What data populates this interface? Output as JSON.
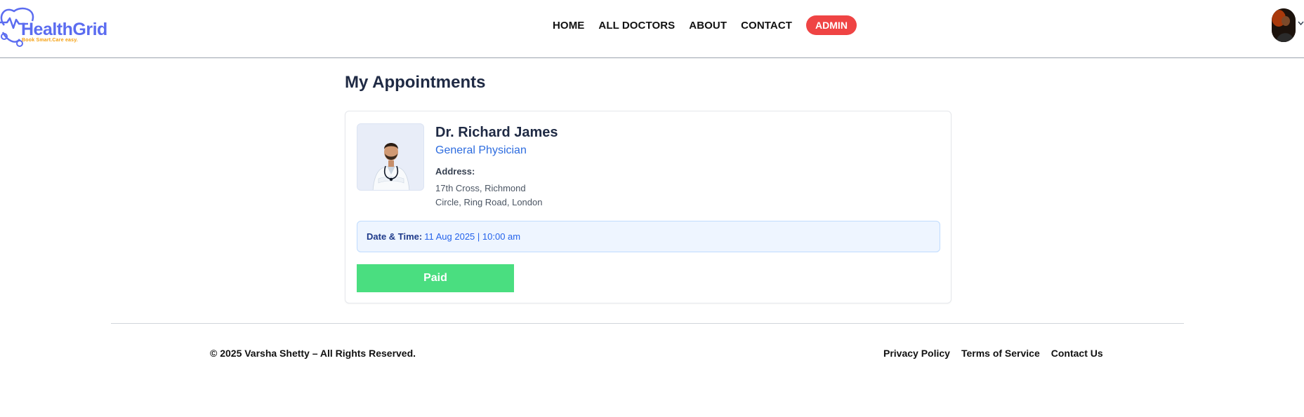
{
  "brand": {
    "name": "HealthGrid",
    "tagline": "Book Smart.Care easy.",
    "color": "#5b6cf0",
    "tagline_color": "#f59e0b"
  },
  "nav": {
    "items": [
      "HOME",
      "ALL DOCTORS",
      "ABOUT",
      "CONTACT"
    ],
    "admin_label": "ADMIN",
    "admin_color": "#ef4444"
  },
  "user_menu": {
    "avatar_icon": "user-avatar",
    "dropdown_icon": "chevron-down-icon"
  },
  "main": {
    "title": "My Appointments",
    "appointments": [
      {
        "doctor_name": "Dr. Richard James",
        "speciality": "General Physician",
        "address_label": "Address:",
        "address_line1": "17th Cross, Richmond",
        "address_line2": "Circle, Ring Road, London",
        "datetime_label": "Date & Time:",
        "datetime_value": "11 Aug 2025 | 10:00 am",
        "status": "Paid",
        "status_color": "#4ade80"
      }
    ]
  },
  "footer": {
    "copyright": "© 2025 Varsha Shetty – All Rights Reserved.",
    "links": [
      "Privacy Policy",
      "Terms of Service",
      "Contact Us"
    ]
  }
}
